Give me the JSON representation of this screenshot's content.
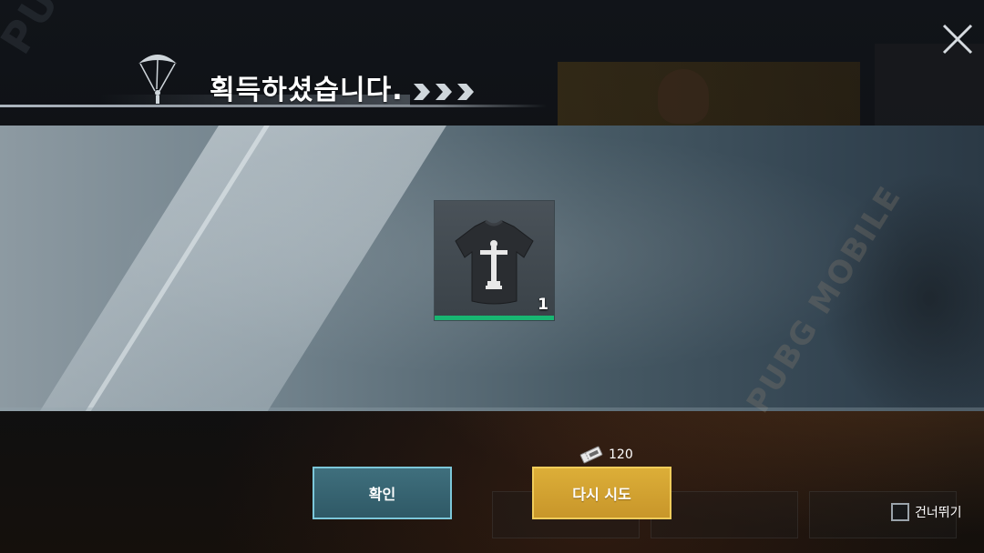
{
  "header": {
    "title": "획득하셨습니다."
  },
  "item": {
    "name": "tshirt-icon",
    "count": "1",
    "rarity_color": "#18b672"
  },
  "actions": {
    "confirm_label": "확인",
    "retry_label": "다시 시도",
    "retry_cost": "120",
    "skip_label": "건너뛰기"
  },
  "watermarks": {
    "left": "PUBG MOBILE",
    "right": "PUBG MOBILE"
  },
  "colors": {
    "confirm_button": "#3f6f7d",
    "retry_button": "#dcae38"
  }
}
